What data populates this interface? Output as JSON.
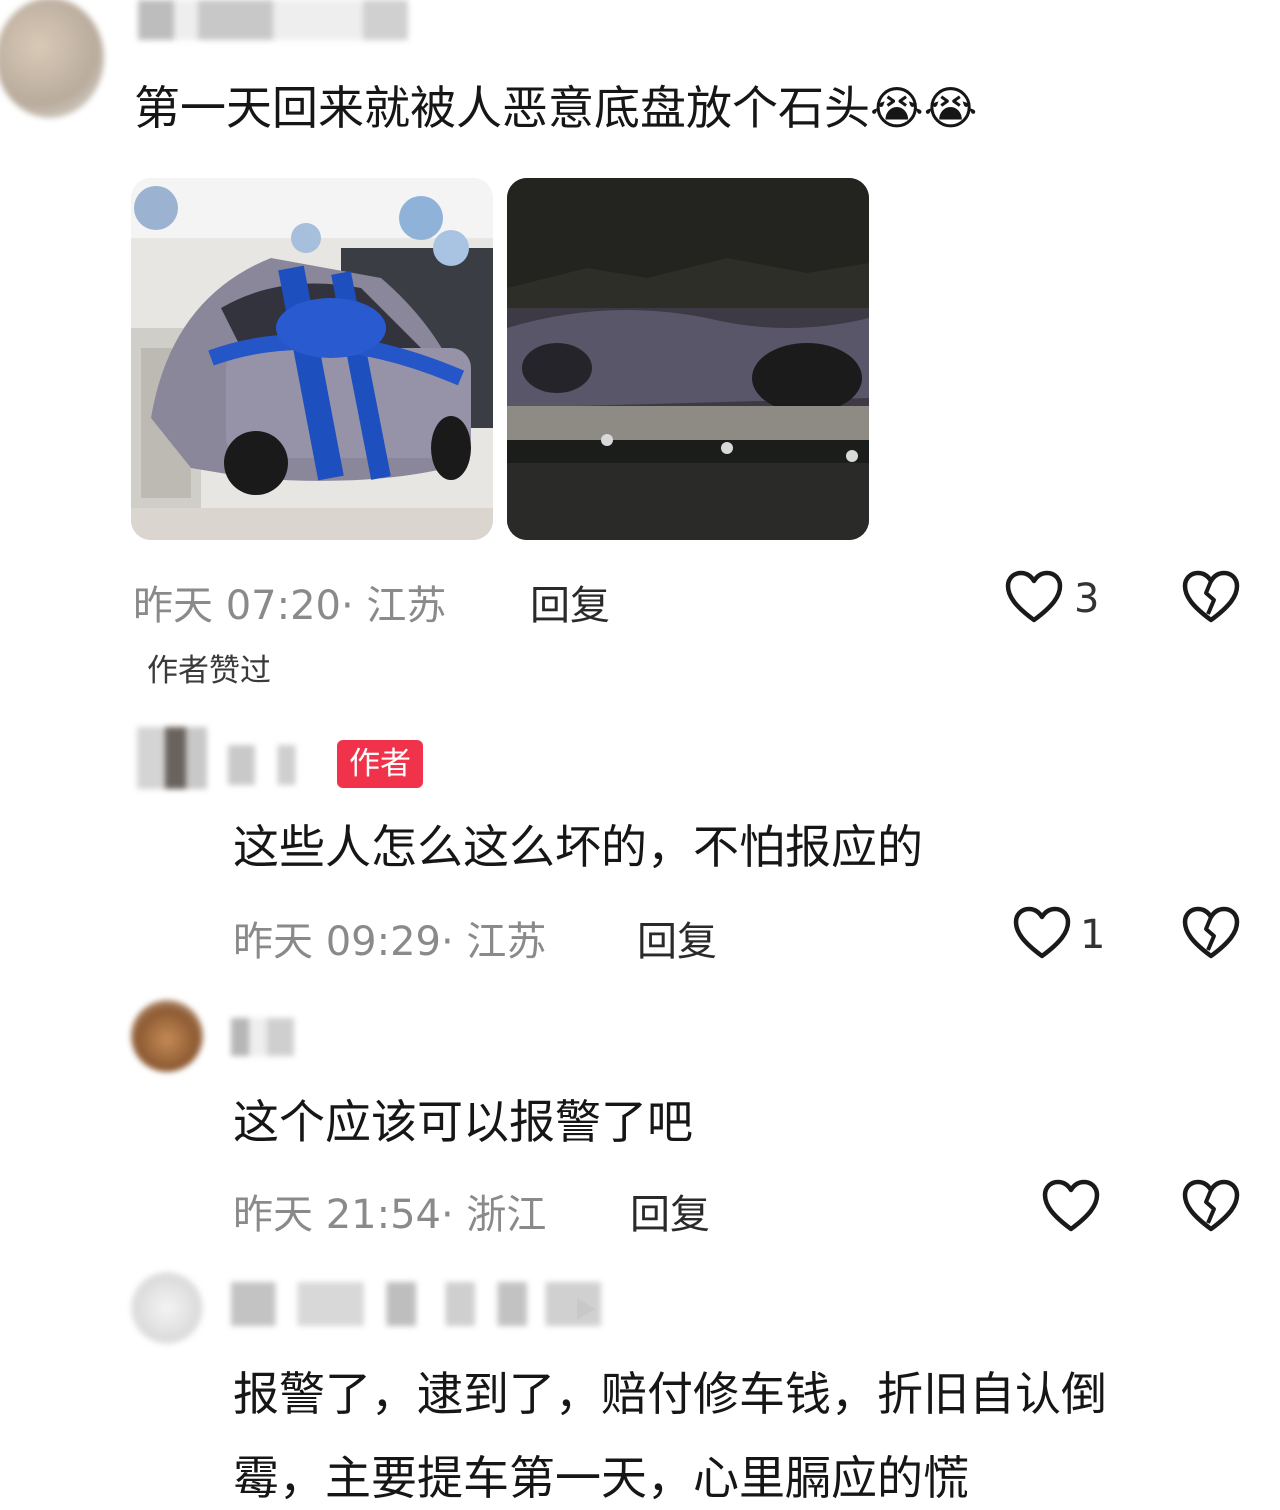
{
  "comments": [
    {
      "text": "第一天回来就被人恶意底盘放个石头😭😭",
      "time": "昨天 07:20",
      "location": "· 江苏",
      "reply_label": "回复",
      "like_count": "3",
      "liked_by_author": "作者赞过"
    },
    {
      "author_badge": "作者",
      "text": "这些人怎么这么坏的，不怕报应的",
      "time": "昨天 09:29",
      "location": "· 江苏",
      "reply_label": "回复",
      "like_count": "1"
    },
    {
      "text": "这个应该可以报警了吧",
      "time": "昨天 21:54",
      "location": "· 浙江",
      "reply_label": "回复",
      "like_count": ""
    },
    {
      "text_line1": "报警了，逮到了，赔付修车钱，折旧自认倒",
      "text_line2": "霉，主要提车第一天，心里膈应的慌"
    }
  ],
  "icons": {
    "like": "heart-outline-icon",
    "dislike": "broken-heart-icon",
    "emoji": "loudly-crying-face-emoji",
    "arrow": "play-arrow-icon"
  },
  "colors": {
    "author_badge_bg": "#f0334a",
    "meta_text": "#8a8a8a",
    "car_wrap": "#1e4fbf"
  }
}
